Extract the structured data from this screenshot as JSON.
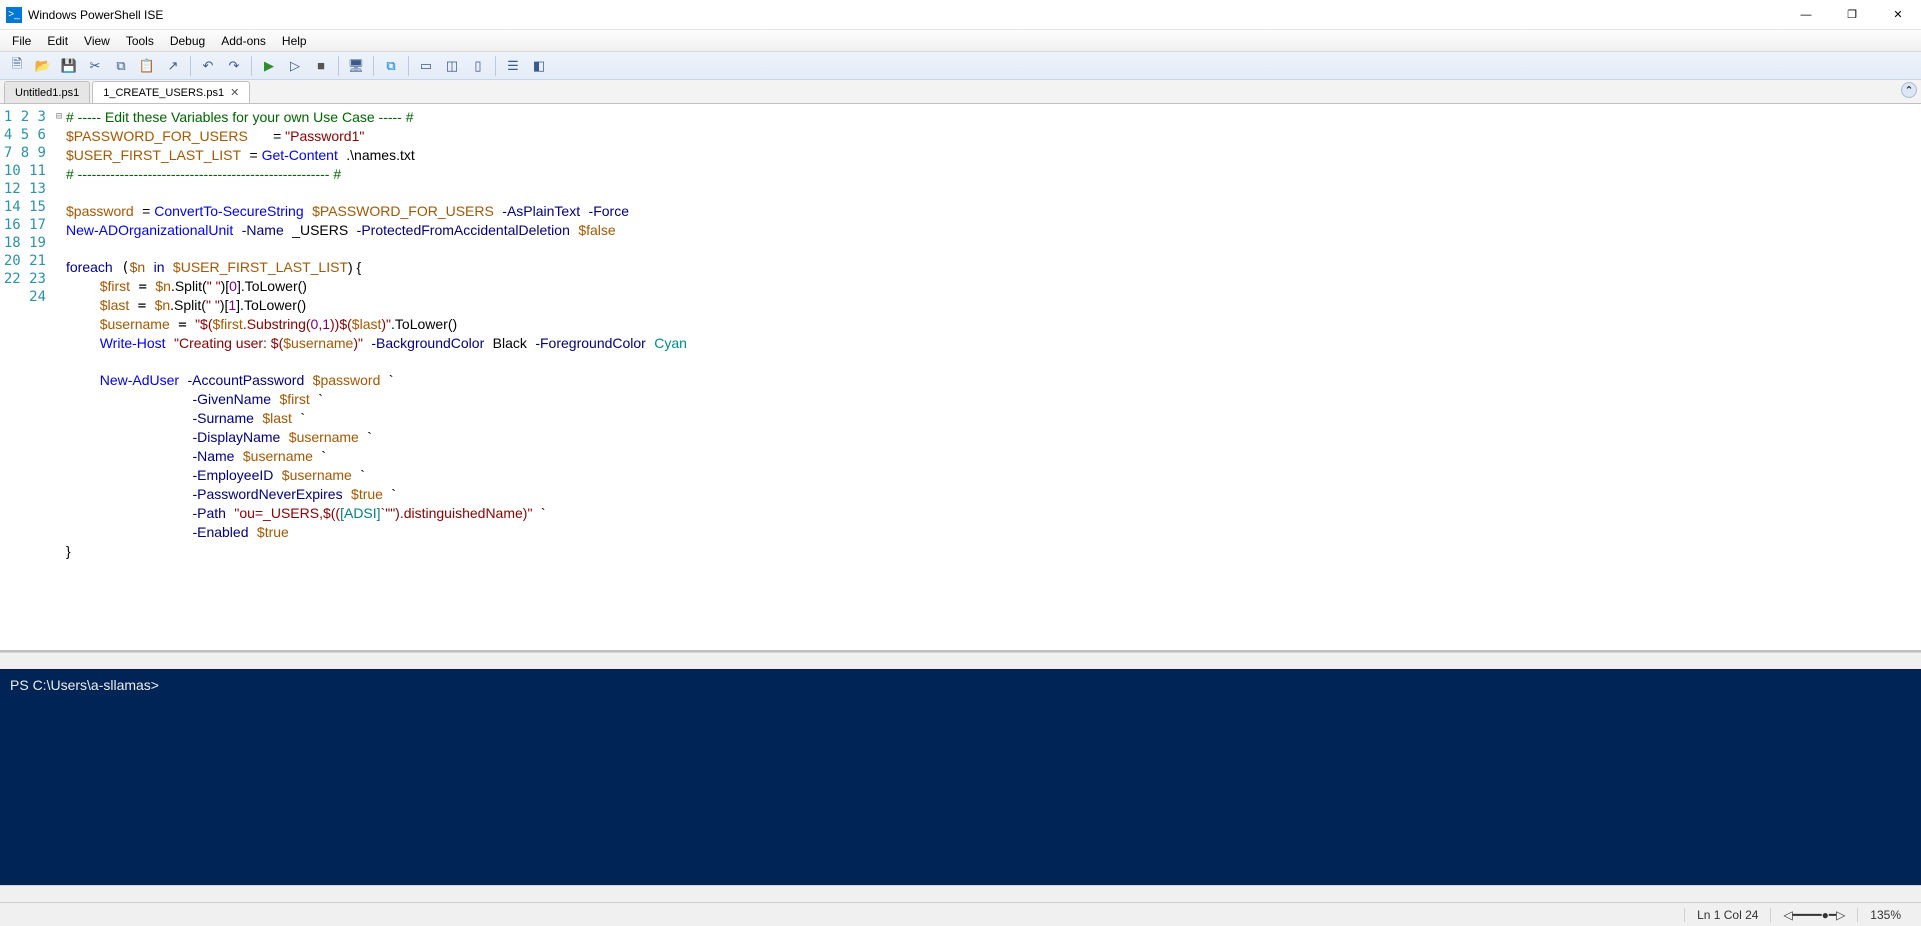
{
  "window": {
    "title": "Windows PowerShell ISE"
  },
  "menus": [
    "File",
    "Edit",
    "View",
    "Tools",
    "Debug",
    "Add-ons",
    "Help"
  ],
  "tabs": [
    {
      "label": "Untitled1.ps1",
      "active": false,
      "closable": false
    },
    {
      "label": "1_CREATE_USERS.ps1",
      "active": true,
      "closable": true
    }
  ],
  "code_lines": [
    {
      "n": 1,
      "tokens": [
        [
          "c-comment",
          "# ----- Edit these Variables for your own Use Case ----- #"
        ]
      ]
    },
    {
      "n": 2,
      "tokens": [
        [
          "c-var",
          "$PASSWORD_FOR_USERS"
        ],
        [
          "",
          "   "
        ],
        [
          "c-black",
          "= "
        ],
        [
          "c-string",
          "\"Password1\""
        ]
      ]
    },
    {
      "n": 3,
      "tokens": [
        [
          "c-var",
          "$USER_FIRST_LAST_LIST"
        ],
        [
          "",
          " "
        ],
        [
          "c-black",
          "= "
        ],
        [
          "c-cmdlet",
          "Get-Content"
        ],
        [
          "",
          " "
        ],
        [
          "c-black",
          ".\\names.txt"
        ]
      ]
    },
    {
      "n": 4,
      "tokens": [
        [
          "c-comment",
          "# ------------------------------------------------------ #"
        ]
      ]
    },
    {
      "n": 5,
      "tokens": [
        [
          "",
          ""
        ]
      ]
    },
    {
      "n": 6,
      "tokens": [
        [
          "c-var",
          "$password"
        ],
        [
          "",
          " "
        ],
        [
          "c-black",
          "= "
        ],
        [
          "c-cmdlet",
          "ConvertTo-SecureString"
        ],
        [
          "",
          " "
        ],
        [
          "c-var",
          "$PASSWORD_FOR_USERS"
        ],
        [
          "",
          " "
        ],
        [
          "c-param",
          "-AsPlainText"
        ],
        [
          "",
          " "
        ],
        [
          "c-param",
          "-Force"
        ]
      ]
    },
    {
      "n": 7,
      "tokens": [
        [
          "c-cmdlet",
          "New-ADOrganizationalUnit"
        ],
        [
          "",
          " "
        ],
        [
          "c-param",
          "-Name"
        ],
        [
          "",
          " "
        ],
        [
          "c-black",
          "_USERS"
        ],
        [
          "",
          " "
        ],
        [
          "c-param",
          "-ProtectedFromAccidentalDeletion"
        ],
        [
          "",
          " "
        ],
        [
          "c-var",
          "$false"
        ]
      ]
    },
    {
      "n": 8,
      "tokens": [
        [
          "",
          ""
        ]
      ]
    },
    {
      "n": 9,
      "fold": "-",
      "tokens": [
        [
          "c-keyword",
          "foreach"
        ],
        [
          "",
          " ("
        ],
        [
          "c-var",
          "$n"
        ],
        [
          "",
          " "
        ],
        [
          "c-keyword",
          "in"
        ],
        [
          "",
          " "
        ],
        [
          "c-var",
          "$USER_FIRST_LAST_LIST"
        ],
        [
          "c-black",
          ") {"
        ]
      ]
    },
    {
      "n": 10,
      "tokens": [
        [
          "",
          "    "
        ],
        [
          "c-var",
          "$first"
        ],
        [
          "",
          " = "
        ],
        [
          "c-var",
          "$n"
        ],
        [
          "c-black",
          ".Split("
        ],
        [
          "c-string",
          "\" \""
        ],
        [
          "c-black",
          ")["
        ],
        [
          "c-number",
          "0"
        ],
        [
          "c-black",
          "].ToLower()"
        ]
      ]
    },
    {
      "n": 11,
      "tokens": [
        [
          "",
          "    "
        ],
        [
          "c-var",
          "$last"
        ],
        [
          "",
          " = "
        ],
        [
          "c-var",
          "$n"
        ],
        [
          "c-black",
          ".Split("
        ],
        [
          "c-string",
          "\" \""
        ],
        [
          "c-black",
          ")["
        ],
        [
          "c-number",
          "1"
        ],
        [
          "c-black",
          "].ToLower()"
        ]
      ]
    },
    {
      "n": 12,
      "tokens": [
        [
          "",
          "    "
        ],
        [
          "c-var",
          "$username"
        ],
        [
          "",
          " = "
        ],
        [
          "c-string",
          "\"$("
        ],
        [
          "c-var",
          "$first"
        ],
        [
          "c-string",
          ".Substring("
        ],
        [
          "c-number",
          "0"
        ],
        [
          "c-string",
          ","
        ],
        [
          "c-number",
          "1"
        ],
        [
          "c-string",
          "))$("
        ],
        [
          "c-var",
          "$last"
        ],
        [
          "c-string",
          ")\""
        ],
        [
          "c-black",
          ".ToLower()"
        ]
      ]
    },
    {
      "n": 13,
      "tokens": [
        [
          "",
          "    "
        ],
        [
          "c-cmdlet",
          "Write-Host"
        ],
        [
          "",
          " "
        ],
        [
          "c-string",
          "\"Creating user: $("
        ],
        [
          "c-var",
          "$username"
        ],
        [
          "c-string",
          ")\""
        ],
        [
          "",
          " "
        ],
        [
          "c-param",
          "-BackgroundColor"
        ],
        [
          "",
          " "
        ],
        [
          "c-black",
          "Black"
        ],
        [
          "",
          " "
        ],
        [
          "c-param",
          "-ForegroundColor"
        ],
        [
          "",
          " "
        ],
        [
          "c-cyan",
          "Cyan"
        ]
      ]
    },
    {
      "n": 14,
      "tokens": [
        [
          "",
          "    "
        ]
      ]
    },
    {
      "n": 15,
      "tokens": [
        [
          "",
          "    "
        ],
        [
          "c-cmdlet",
          "New-AdUser"
        ],
        [
          "",
          " "
        ],
        [
          "c-param",
          "-AccountPassword"
        ],
        [
          "",
          " "
        ],
        [
          "c-var",
          "$password"
        ],
        [
          "",
          " "
        ],
        [
          "c-black",
          "`"
        ]
      ]
    },
    {
      "n": 16,
      "tokens": [
        [
          "",
          "               "
        ],
        [
          "c-param",
          "-GivenName"
        ],
        [
          "",
          " "
        ],
        [
          "c-var",
          "$first"
        ],
        [
          "",
          " "
        ],
        [
          "c-black",
          "`"
        ]
      ]
    },
    {
      "n": 17,
      "tokens": [
        [
          "",
          "               "
        ],
        [
          "c-param",
          "-Surname"
        ],
        [
          "",
          " "
        ],
        [
          "c-var",
          "$last"
        ],
        [
          "",
          " "
        ],
        [
          "c-black",
          "`"
        ]
      ]
    },
    {
      "n": 18,
      "tokens": [
        [
          "",
          "               "
        ],
        [
          "c-param",
          "-DisplayName"
        ],
        [
          "",
          " "
        ],
        [
          "c-var",
          "$username"
        ],
        [
          "",
          " "
        ],
        [
          "c-black",
          "`"
        ]
      ]
    },
    {
      "n": 19,
      "tokens": [
        [
          "",
          "               "
        ],
        [
          "c-param",
          "-Name"
        ],
        [
          "",
          " "
        ],
        [
          "c-var",
          "$username"
        ],
        [
          "",
          " "
        ],
        [
          "c-black",
          "`"
        ]
      ]
    },
    {
      "n": 20,
      "tokens": [
        [
          "",
          "               "
        ],
        [
          "c-param",
          "-EmployeeID"
        ],
        [
          "",
          " "
        ],
        [
          "c-var",
          "$username"
        ],
        [
          "",
          " "
        ],
        [
          "c-black",
          "`"
        ]
      ]
    },
    {
      "n": 21,
      "tokens": [
        [
          "",
          "               "
        ],
        [
          "c-param",
          "-PasswordNeverExpires"
        ],
        [
          "",
          " "
        ],
        [
          "c-var",
          "$true"
        ],
        [
          "",
          " "
        ],
        [
          "c-black",
          "`"
        ]
      ]
    },
    {
      "n": 22,
      "tokens": [
        [
          "",
          "               "
        ],
        [
          "c-param",
          "-Path"
        ],
        [
          "",
          " "
        ],
        [
          "c-string",
          "\"ou=_USERS,$(("
        ],
        [
          "c-type",
          "[ADSI]"
        ],
        [
          "c-string",
          "`\"\").distinguishedName)\""
        ],
        [
          "",
          " "
        ],
        [
          "c-black",
          "`"
        ]
      ]
    },
    {
      "n": 23,
      "tokens": [
        [
          "",
          "               "
        ],
        [
          "c-param",
          "-Enabled"
        ],
        [
          "",
          " "
        ],
        [
          "c-var",
          "$true"
        ]
      ]
    },
    {
      "n": 24,
      "tokens": [
        [
          "c-black",
          "}"
        ]
      ]
    }
  ],
  "console": {
    "prompt": "PS C:\\Users\\a-sllamas> "
  },
  "status": {
    "position": "Ln 1  Col 24",
    "zoom": "135%"
  },
  "toolbar_icons": [
    {
      "name": "new-file-icon",
      "glyph": "🗎"
    },
    {
      "name": "open-file-icon",
      "glyph": "📂"
    },
    {
      "name": "save-icon",
      "glyph": "💾"
    },
    {
      "name": "cut-icon",
      "glyph": "✂"
    },
    {
      "name": "copy-icon",
      "glyph": "⧉"
    },
    {
      "name": "paste-icon",
      "glyph": "📋"
    },
    {
      "name": "clear-icon",
      "glyph": "↗"
    },
    {
      "name": "sep"
    },
    {
      "name": "undo-icon",
      "glyph": "↶"
    },
    {
      "name": "redo-icon",
      "glyph": "↷"
    },
    {
      "name": "sep"
    },
    {
      "name": "run-script-icon",
      "glyph": "▶",
      "color": "#2e8b2e"
    },
    {
      "name": "run-selection-icon",
      "glyph": "▷"
    },
    {
      "name": "stop-icon",
      "glyph": "■",
      "color": "#555"
    },
    {
      "name": "sep"
    },
    {
      "name": "remote-icon",
      "glyph": "🖥"
    },
    {
      "name": "sep"
    },
    {
      "name": "powershell-icon",
      "glyph": "⧉",
      "color": "#0078d4"
    },
    {
      "name": "sep"
    },
    {
      "name": "show-script-top-icon",
      "glyph": "▭"
    },
    {
      "name": "show-script-right-icon",
      "glyph": "◫"
    },
    {
      "name": "show-script-max-icon",
      "glyph": "▯"
    },
    {
      "name": "sep"
    },
    {
      "name": "show-command-icon",
      "glyph": "☰"
    },
    {
      "name": "show-addon-icon",
      "glyph": "◧"
    }
  ]
}
